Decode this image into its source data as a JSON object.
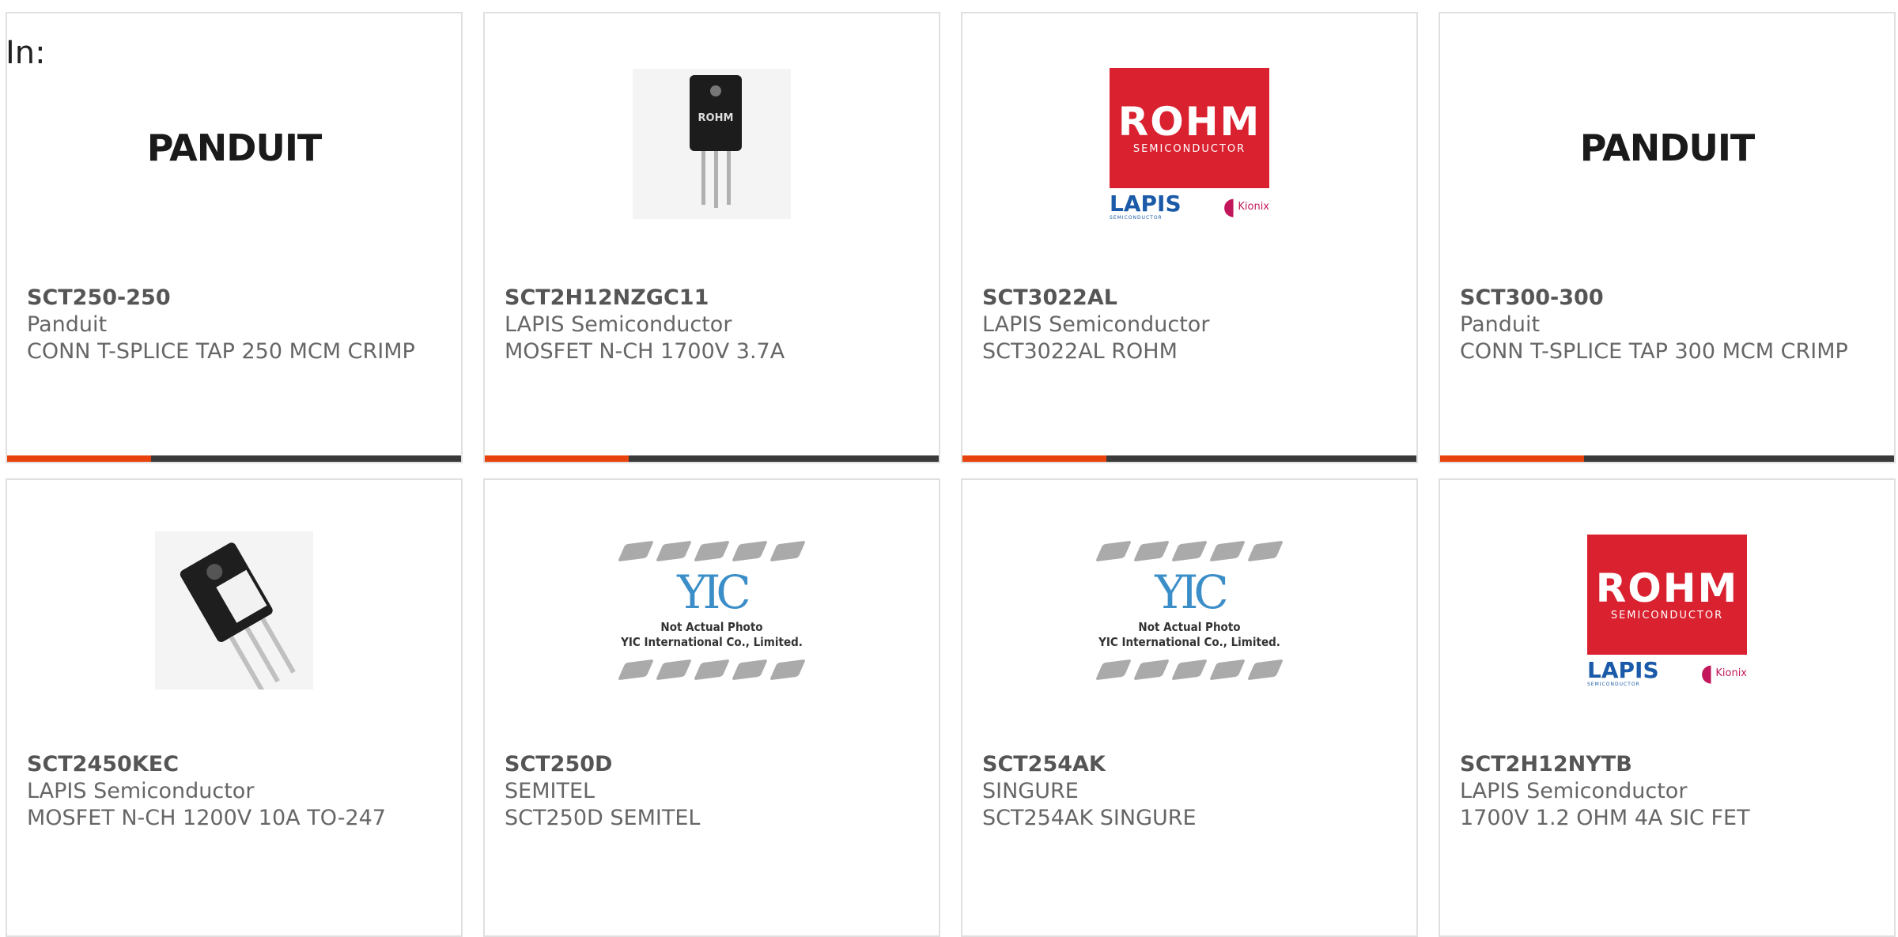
{
  "filter_label": "In:",
  "products": [
    {
      "part": "SCT250-250",
      "manufacturer": "Panduit",
      "description": "CONN T-SPLICE TAP 250 MCM CRIMP",
      "image": "panduit-logo"
    },
    {
      "part": "SCT2H12NZGC11",
      "manufacturer": "LAPIS Semiconductor",
      "description": "MOSFET N-CH 1700V 3.7A",
      "image": "to-package-photo"
    },
    {
      "part": "SCT3022AL",
      "manufacturer": "LAPIS Semiconductor",
      "description": "SCT3022AL ROHM",
      "image": "rohm-logo"
    },
    {
      "part": "SCT300-300",
      "manufacturer": "Panduit",
      "description": "CONN T-SPLICE TAP 300 MCM CRIMP",
      "image": "panduit-logo"
    },
    {
      "part": "SCT2450KEC",
      "manufacturer": "LAPIS Semiconductor",
      "description": "MOSFET N-CH 1200V 10A TO-247",
      "image": "to247-photo"
    },
    {
      "part": "SCT250D",
      "manufacturer": "SEMITEL",
      "description": "SCT250D SEMITEL",
      "image": "yic-placeholder"
    },
    {
      "part": "SCT254AK",
      "manufacturer": "SINGURE",
      "description": "SCT254AK SINGURE",
      "image": "yic-placeholder"
    },
    {
      "part": "SCT2H12NYTB",
      "manufacturer": "LAPIS Semiconductor",
      "description": "1700V 1.2 OHM 4A SIC FET",
      "image": "rohm-logo"
    }
  ],
  "logos": {
    "panduit": "PANDUIT",
    "rohm": "ROHM",
    "rohm_sub": "SEMICONDUCTOR",
    "lapis": "LAPIS",
    "lapis_sub": "SEMICONDUCTOR",
    "kionix": "Kionix",
    "yic_mark": "YIC",
    "yic_cap1": "Not Actual Photo",
    "yic_cap2": "YIC International Co., Limited.",
    "to_package_marking": "ROHM"
  },
  "colors": {
    "accent": "#e8430e",
    "bar": "#3a3a3a",
    "rohm_red": "#d9212f",
    "lapis_blue": "#1a5aa8"
  }
}
